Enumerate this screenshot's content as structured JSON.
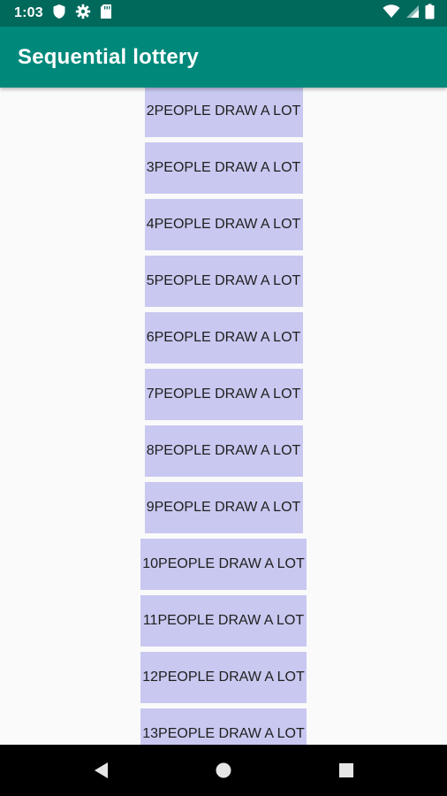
{
  "status_bar": {
    "time": "1:03",
    "icons": [
      "shield-icon",
      "gear-icon",
      "sd-card-icon",
      "wifi-icon",
      "signal-icon",
      "battery-icon"
    ]
  },
  "app_bar": {
    "title": "Sequential lottery"
  },
  "buttons": [
    "2PEOPLE DRAW A LOT",
    "3PEOPLE DRAW A LOT",
    "4PEOPLE DRAW A LOT",
    "5PEOPLE DRAW A LOT",
    "6PEOPLE DRAW A LOT",
    "7PEOPLE DRAW A LOT",
    "8PEOPLE DRAW A LOT",
    "9PEOPLE DRAW A LOT",
    "10PEOPLE DRAW A LOT",
    "11PEOPLE DRAW A LOT",
    "12PEOPLE DRAW A LOT",
    "13PEOPLE DRAW A LOT"
  ],
  "nav_bar": {
    "buttons": [
      "back-icon",
      "home-icon",
      "recents-icon"
    ]
  },
  "colors": {
    "status_bar": "#00695c",
    "app_bar": "#00897b",
    "button_bg": "#c9c8f0",
    "background": "#fafafa"
  }
}
